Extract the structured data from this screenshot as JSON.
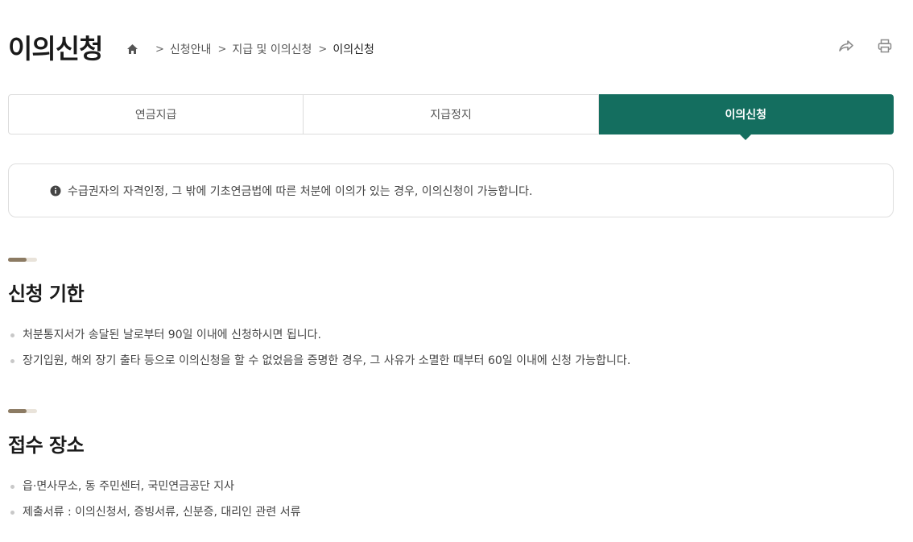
{
  "header": {
    "title": "이의신청",
    "breadcrumb": [
      "신청안내",
      "지급 및 이의신청",
      "이의신청"
    ]
  },
  "tabs": [
    "연금지급",
    "지급정지",
    "이의신청"
  ],
  "active_tab_index": 2,
  "notice": {
    "icon": "info-icon",
    "text": "수급권자의 자격인정, 그 밖에 기초연금법에 따른 처분에 이의가 있는 경우, 이의신청이 가능합니다."
  },
  "sections": [
    {
      "title": "신청 기한",
      "items": [
        "처분통지서가 송달된 날로부터 90일 이내에 신청하시면 됩니다.",
        "장기입원, 해외 장기 출타 등으로 이의신청을 할 수 없었음을 증명한 경우, 그 사유가 소멸한 때부터 60일 이내에 신청 가능합니다."
      ]
    },
    {
      "title": "접수 장소",
      "items": [
        "읍·면사무소, 동 주민센터, 국민연금공단 지사",
        "제출서류 : 이의신청서, 증빙서류, 신분증, 대리인 관련 서류"
      ]
    }
  ],
  "colors": {
    "active_tab": "#146e5f",
    "section_bar": "#8c7b63"
  }
}
